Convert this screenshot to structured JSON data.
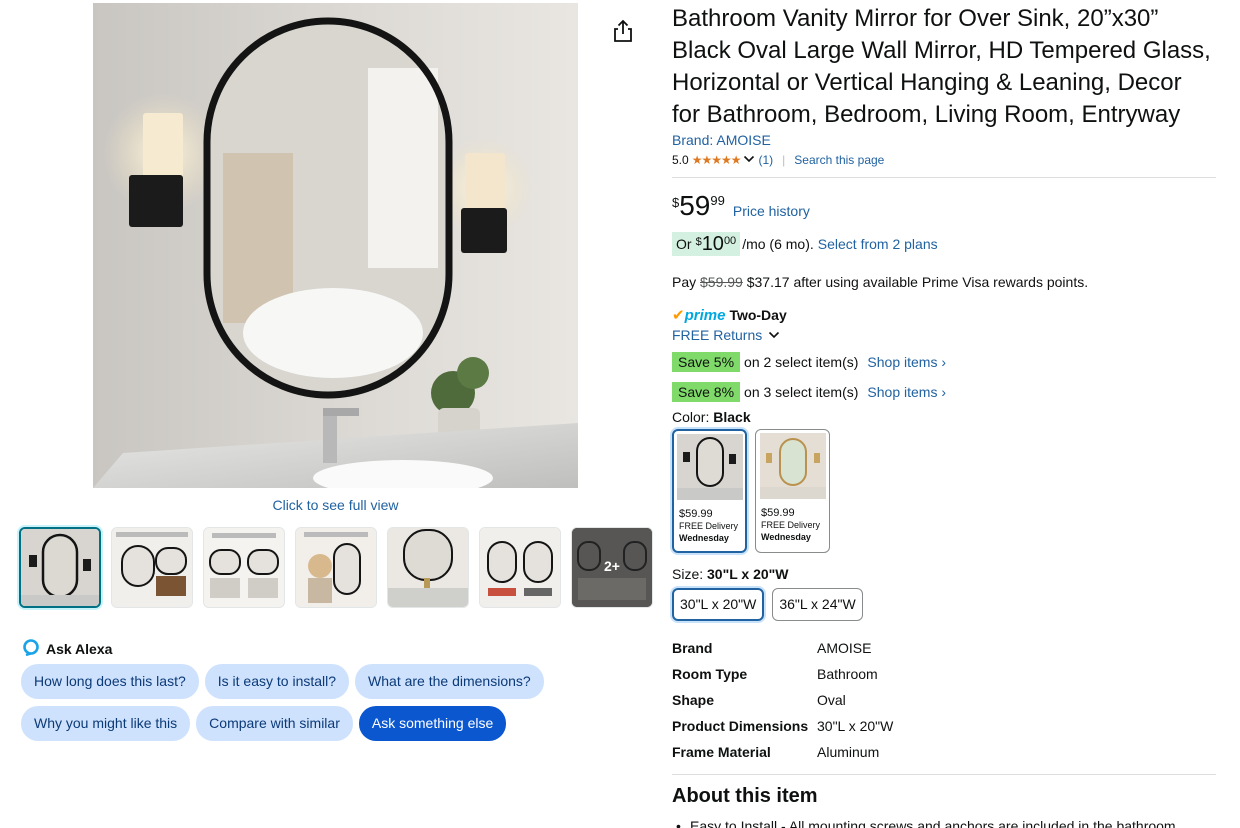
{
  "gallery": {
    "click_full_view": "Click to see full view",
    "more_count": "2+"
  },
  "alexa": {
    "label": "Ask Alexa",
    "chips_row1": [
      "How long does this last?",
      "Is it easy to install?",
      "What are the dimensions?"
    ],
    "chips_row2": [
      "Why you might like this",
      "Compare with similar"
    ],
    "ask_else": "Ask something else"
  },
  "product": {
    "title": "Bathroom Vanity Mirror for Over Sink, 20”x30” Black Oval Large Wall Mirror, HD Tempered Glass, Horizontal or Vertical Hanging & Leaning, Decor for Bathroom, Bedroom, Living Room, Entryway",
    "brand_link": "Brand: AMOISE",
    "rating": "5.0",
    "stars": "★★★★★",
    "review_count": "(1)",
    "search_page": "Search this page",
    "price_symbol": "$",
    "price_whole": "59",
    "price_fraction": "99",
    "price_history": "Price history",
    "monthly_or": "Or",
    "monthly_symbol": "$",
    "monthly_whole": "10",
    "monthly_fraction": "00",
    "monthly_term": "/mo (6 mo).",
    "monthly_plans": "Select from 2 plans",
    "pay_prefix": "Pay",
    "pay_original": "$59.99",
    "pay_after": "$37.17 after using available Prime Visa rewards points.",
    "prime_word": "prime",
    "prime_delivery": "Two-Day",
    "free_returns": "FREE Returns",
    "save_offers": [
      {
        "badge": "Save 5%",
        "text": "on 2 select item(s)",
        "link": "Shop items ›"
      },
      {
        "badge": "Save 8%",
        "text": "on 3 select item(s)",
        "link": "Shop items ›"
      }
    ],
    "color_label": "Color:",
    "color_value": "Black",
    "swatches": [
      {
        "price": "$59.99",
        "delivery": "FREE Delivery",
        "day": "Wednesday"
      },
      {
        "price": "$59.99",
        "delivery": "FREE Delivery",
        "day": "Wednesday"
      }
    ],
    "size_label": "Size:",
    "size_value": "30\"L x 20\"W",
    "sizes": [
      "30\"L x 20\"W",
      "36\"L x 24\"W"
    ],
    "specs": [
      {
        "k": "Brand",
        "v": "AMOISE"
      },
      {
        "k": "Room Type",
        "v": "Bathroom"
      },
      {
        "k": "Shape",
        "v": "Oval"
      },
      {
        "k": "Product Dimensions",
        "v": "30\"L x 20\"W"
      },
      {
        "k": "Frame Material",
        "v": "Aluminum"
      }
    ],
    "about_title": "About this item",
    "about_bullet": "Easy to Install - All mounting screws and anchors are included in the bathroom"
  },
  "colors": {
    "link": "#2162a1",
    "prime_blue": "#00a8e1",
    "save_green": "#7fda69",
    "alexa_chip": "#cfe2fd",
    "alexa_primary": "#0b57d0",
    "star": "#de7921"
  }
}
